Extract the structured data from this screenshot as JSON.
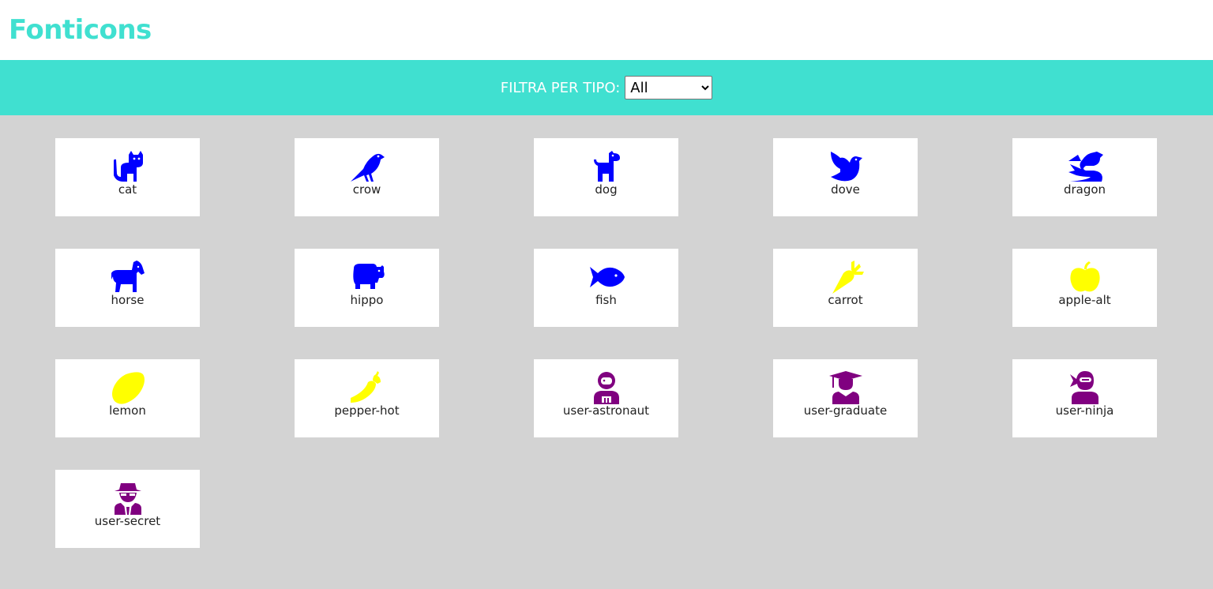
{
  "header": {
    "title": "Fonticons"
  },
  "filter": {
    "label": "FILTRA PER TIPO:",
    "selected": "All",
    "options": [
      "All"
    ]
  },
  "colors": {
    "accent": "#40e0d0",
    "animal": "#0000ff",
    "vegetable": "#ffff00",
    "user": "#800080"
  },
  "icons": [
    {
      "name": "cat",
      "color": "#0000ff",
      "icon": "cat-icon"
    },
    {
      "name": "crow",
      "color": "#0000ff",
      "icon": "crow-icon"
    },
    {
      "name": "dog",
      "color": "#0000ff",
      "icon": "dog-icon"
    },
    {
      "name": "dove",
      "color": "#0000ff",
      "icon": "dove-icon"
    },
    {
      "name": "dragon",
      "color": "#0000ff",
      "icon": "dragon-icon"
    },
    {
      "name": "horse",
      "color": "#0000ff",
      "icon": "horse-icon"
    },
    {
      "name": "hippo",
      "color": "#0000ff",
      "icon": "hippo-icon"
    },
    {
      "name": "fish",
      "color": "#0000ff",
      "icon": "fish-icon"
    },
    {
      "name": "carrot",
      "color": "#ffff00",
      "icon": "carrot-icon"
    },
    {
      "name": "apple-alt",
      "color": "#ffff00",
      "icon": "apple-icon"
    },
    {
      "name": "lemon",
      "color": "#ffff00",
      "icon": "lemon-icon"
    },
    {
      "name": "pepper-hot",
      "color": "#ffff00",
      "icon": "pepper-icon"
    },
    {
      "name": "user-astronaut",
      "color": "#800080",
      "icon": "astronaut-icon"
    },
    {
      "name": "user-graduate",
      "color": "#800080",
      "icon": "graduate-icon"
    },
    {
      "name": "user-ninja",
      "color": "#800080",
      "icon": "ninja-icon"
    },
    {
      "name": "user-secret",
      "color": "#800080",
      "icon": "secret-icon"
    }
  ]
}
